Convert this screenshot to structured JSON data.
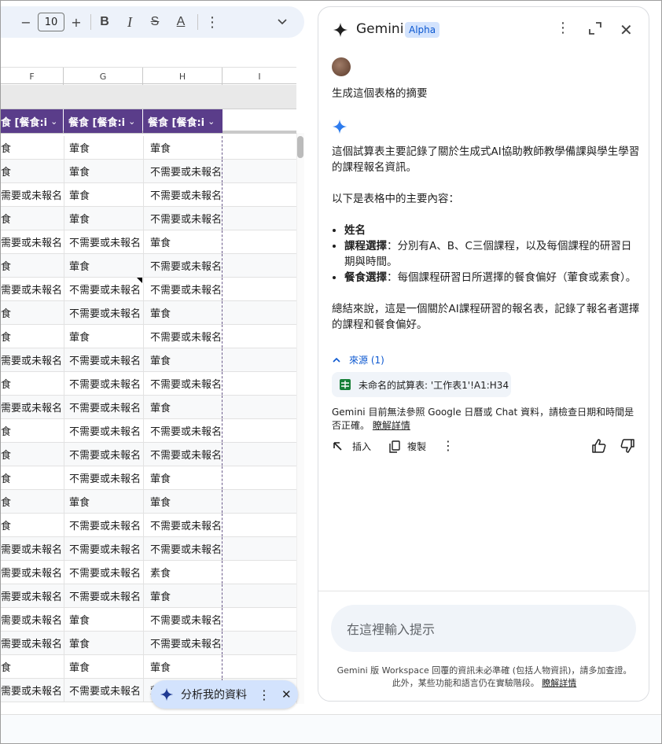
{
  "toolbar": {
    "minus": "−",
    "font_size": "10",
    "plus": "+",
    "bold": "B",
    "italic": "I",
    "strike": "S",
    "text_color": "A",
    "more": "⋮",
    "expand": "⌄"
  },
  "columns": [
    "F",
    "G",
    "H",
    "I"
  ],
  "header_cells": [
    "食 [餐食:i",
    "餐食 [餐食:i",
    "餐食 [餐食:i"
  ],
  "rows": [
    [
      "食",
      "葷食",
      "葷食"
    ],
    [
      "食",
      "葷食",
      "不需要或未報名"
    ],
    [
      "需要或未報名",
      "葷食",
      "不需要或未報名"
    ],
    [
      "食",
      "葷食",
      "不需要或未報名"
    ],
    [
      "需要或未報名",
      "不需要或未報名",
      "葷食"
    ],
    [
      "食",
      "葷食",
      "不需要或未報名"
    ],
    [
      "需要或未報名",
      "不需要或未報名",
      "不需要或未報名"
    ],
    [
      "食",
      "不需要或未報名",
      "葷食"
    ],
    [
      "食",
      "葷食",
      "不需要或未報名"
    ],
    [
      "需要或未報名",
      "不需要或未報名",
      "葷食"
    ],
    [
      "食",
      "不需要或未報名",
      "不需要或未報名"
    ],
    [
      "需要或未報名",
      "不需要或未報名",
      "葷食"
    ],
    [
      "食",
      "不需要或未報名",
      "不需要或未報名"
    ],
    [
      "食",
      "不需要或未報名",
      "不需要或未報名"
    ],
    [
      "食",
      "不需要或未報名",
      "葷食"
    ],
    [
      "食",
      "葷食",
      "葷食"
    ],
    [
      "食",
      "不需要或未報名",
      "不需要或未報名"
    ],
    [
      "需要或未報名",
      "不需要或未報名",
      "不需要或未報名"
    ],
    [
      "需要或未報名",
      "不需要或未報名",
      "素食"
    ],
    [
      "需要或未報名",
      "不需要或未報名",
      "葷食"
    ],
    [
      "需要或未報名",
      "葷食",
      "不需要或未報名"
    ],
    [
      "需要或未報名",
      "葷食",
      "不需要或未報名"
    ],
    [
      "食",
      "葷食",
      "葷食"
    ],
    [
      "需要或未報名",
      "不需要或未報名",
      "葷食"
    ]
  ],
  "analyze_chip": {
    "label": "分析我的資料"
  },
  "panel": {
    "title": "Gemini",
    "badge": "Alpha",
    "user_prompt": "生成這個表格的摘要",
    "response_intro": "這個試算表主要記錄了關於生成式AI協助教師教學備課與學生學習的課程報名資訊。",
    "response_lead": "以下是表格中的主要內容：",
    "bullets": [
      {
        "term": "姓名",
        "text": ""
      },
      {
        "term": "課程選擇",
        "text": "：分別有A、B、C三個課程，以及每個課程的研習日期與時間。"
      },
      {
        "term": "餐食選擇",
        "text": "：每個課程研習日所選擇的餐食偏好（葷食或素食）。"
      }
    ],
    "response_summary": "總結來說，這是一個關於AI課程研習的報名表，記錄了報名者選擇的課程和餐食偏好。",
    "sources_label": "來源 (1)",
    "source_chip": "未命名的試算表: '工作表1'!A1:H34",
    "disclaimer_text": "Gemini 目前無法參照 Google 日曆或 Chat 資料，請檢查日期和時間是否正確。",
    "disclaimer_link": "瞭解詳情",
    "insert_label": "插入",
    "copy_label": "複製",
    "input_placeholder": "在這裡輸入提示",
    "footnote_text": "Gemini 版 Workspace 回覆的資訊未必準確 (包括人物資訊)，請多加查證。此外，某些功能和語言仍在實驗階段。",
    "footnote_link": "瞭解詳情"
  },
  "icons": [
    "sparkle-icon",
    "more-vert-icon",
    "expand-icon",
    "close-icon",
    "sheets-icon",
    "insert-icon",
    "copy-icon",
    "thumb-up-icon",
    "thumb-down-icon"
  ],
  "colors": {
    "header_purple": "#5a3d8a",
    "gemini_blue": "#1a73e8",
    "badge_bg": "#d3e3fd",
    "link_blue": "#0b57d0"
  }
}
